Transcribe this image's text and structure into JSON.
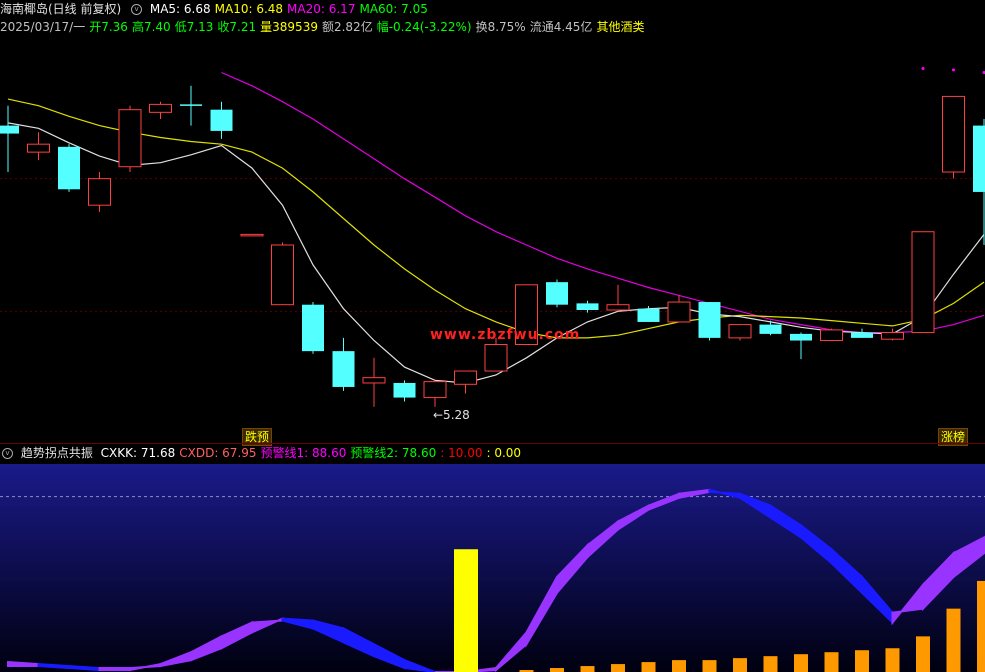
{
  "header": {
    "title": "海南椰岛(日线 前复权)",
    "ma": [
      {
        "label": "MA5: 6.68",
        "color": "#ffffff"
      },
      {
        "label": "MA10: 6.48",
        "color": "#ffff00"
      },
      {
        "label": "MA20: 6.17",
        "color": "#ff00ff"
      },
      {
        "label": "MA60: 7.05",
        "color": "#00ff00"
      }
    ],
    "quote": [
      {
        "label": "2025/03/17/一",
        "color": "#c0c0c0"
      },
      {
        "label": "开7.36",
        "color": "#00ff00"
      },
      {
        "label": "高7.40",
        "color": "#00ff00"
      },
      {
        "label": "低7.13",
        "color": "#00ff00"
      },
      {
        "label": "收7.21",
        "color": "#00ff00"
      },
      {
        "label": "量389539",
        "color": "#ffff00"
      },
      {
        "label": "额2.82亿",
        "color": "#c0c0c0"
      },
      {
        "label": "幅-0.24(-3.22%)",
        "color": "#00ff00"
      },
      {
        "label": "换8.75%",
        "color": "#c0c0c0"
      },
      {
        "label": "流通4.45亿",
        "color": "#c0c0c0"
      },
      {
        "label": "其他酒类",
        "color": "#ffff00"
      }
    ]
  },
  "indicator_header": {
    "name": "趋势拐点共振",
    "items": [
      {
        "label": "CXKK: 71.68",
        "color": "#ffffff"
      },
      {
        "label": "CXDD: 67.95",
        "color": "#ff6060"
      },
      {
        "label": "预警线1: 88.60",
        "color": "#ff00ff"
      },
      {
        "label": "预警线2: 78.60",
        "color": "#00ff00"
      },
      {
        "label": ": 10.00",
        "color": "#ff0000"
      },
      {
        "label": ": 0.00",
        "color": "#ffff00"
      }
    ]
  },
  "badges": {
    "left": "跌预",
    "right": "涨榜"
  },
  "low_label": "←5.28",
  "watermark": "www.zbzfwu.com",
  "colors": {
    "up": "#ff4040",
    "down": "#54ffff",
    "ma5": "#e0e0e0",
    "ma10": "#e0e000",
    "ma20": "#e000e0",
    "kk": "#9933ff",
    "dd": "#1a1aff",
    "bar": "#ffff00",
    "small_bar": "#ff9900"
  },
  "chart_data": [
    {
      "type": "candlestick",
      "title": "海南椰岛(日线 前复权)",
      "ylim": [
        5.0,
        8.0
      ],
      "candles": [
        {
          "o": 7.4,
          "c": 7.34,
          "h": 7.55,
          "l": 7.05
        },
        {
          "o": 7.2,
          "c": 7.26,
          "h": 7.35,
          "l": 7.14
        },
        {
          "o": 7.24,
          "c": 6.92,
          "h": 7.26,
          "l": 6.9
        },
        {
          "o": 6.8,
          "c": 7.0,
          "h": 7.05,
          "l": 6.75
        },
        {
          "o": 7.09,
          "c": 7.52,
          "h": 7.55,
          "l": 7.05
        },
        {
          "o": 7.5,
          "c": 7.56,
          "h": 7.58,
          "l": 7.45
        },
        {
          "o": 7.56,
          "c": 7.55,
          "h": 7.7,
          "l": 7.4
        },
        {
          "o": 7.52,
          "c": 7.36,
          "h": 7.58,
          "l": 7.3
        },
        {
          "o": 6.58,
          "c": 6.58,
          "h": 6.58,
          "l": 6.58
        },
        {
          "o": 6.05,
          "c": 6.5,
          "h": 6.52,
          "l": 6.05
        },
        {
          "o": 6.05,
          "c": 5.7,
          "h": 6.07,
          "l": 5.68
        },
        {
          "o": 5.7,
          "c": 5.43,
          "h": 5.8,
          "l": 5.4
        },
        {
          "o": 5.46,
          "c": 5.5,
          "h": 5.65,
          "l": 5.28
        },
        {
          "o": 5.46,
          "c": 5.35,
          "h": 5.48,
          "l": 5.32
        },
        {
          "o": 5.35,
          "c": 5.47,
          "h": 5.47,
          "l": 5.28
        },
        {
          "o": 5.45,
          "c": 5.55,
          "h": 5.55,
          "l": 5.38
        },
        {
          "o": 5.55,
          "c": 5.75,
          "h": 5.8,
          "l": 5.55
        },
        {
          "o": 5.75,
          "c": 6.2,
          "h": 6.2,
          "l": 5.75
        },
        {
          "o": 6.22,
          "c": 6.05,
          "h": 6.24,
          "l": 6.03
        },
        {
          "o": 6.06,
          "c": 6.01,
          "h": 6.08,
          "l": 5.99
        },
        {
          "o": 6.01,
          "c": 6.05,
          "h": 6.2,
          "l": 6.0
        },
        {
          "o": 6.02,
          "c": 5.92,
          "h": 6.04,
          "l": 5.92
        },
        {
          "o": 5.92,
          "c": 6.07,
          "h": 6.12,
          "l": 5.92
        },
        {
          "o": 6.07,
          "c": 5.8,
          "h": 6.07,
          "l": 5.78
        },
        {
          "o": 5.8,
          "c": 5.9,
          "h": 5.9,
          "l": 5.78
        },
        {
          "o": 5.9,
          "c": 5.83,
          "h": 5.93,
          "l": 5.82
        },
        {
          "o": 5.83,
          "c": 5.78,
          "h": 5.84,
          "l": 5.64
        },
        {
          "o": 5.78,
          "c": 5.86,
          "h": 5.87,
          "l": 5.78
        },
        {
          "o": 5.84,
          "c": 5.8,
          "h": 5.87,
          "l": 5.8
        },
        {
          "o": 5.79,
          "c": 5.84,
          "h": 5.87,
          "l": 5.78
        },
        {
          "o": 5.84,
          "c": 6.6,
          "h": 6.6,
          "l": 5.84
        },
        {
          "o": 7.05,
          "c": 7.62,
          "h": 7.62,
          "l": 7.0
        },
        {
          "o": 7.4,
          "c": 6.9,
          "h": 7.45,
          "l": 6.5
        }
      ],
      "ma5": [
        7.42,
        7.38,
        7.27,
        7.17,
        7.1,
        7.12,
        7.18,
        7.25,
        7.08,
        6.8,
        6.35,
        6.02,
        5.78,
        5.58,
        5.48,
        5.46,
        5.52,
        5.65,
        5.8,
        5.92,
        6.0,
        6.02,
        6.03,
        5.98,
        5.96,
        5.92,
        5.88,
        5.85,
        5.84,
        5.83,
        5.96,
        6.28,
        6.58
      ],
      "ma10": [
        7.6,
        7.55,
        7.47,
        7.4,
        7.35,
        7.31,
        7.28,
        7.26,
        7.2,
        7.08,
        6.9,
        6.7,
        6.5,
        6.32,
        6.16,
        6.02,
        5.92,
        5.84,
        5.8,
        5.8,
        5.82,
        5.87,
        5.92,
        5.95,
        5.97,
        5.96,
        5.95,
        5.93,
        5.91,
        5.89,
        5.94,
        6.06,
        6.22
      ],
      "ma20": [
        null,
        null,
        null,
        null,
        null,
        null,
        null,
        7.8,
        7.7,
        7.58,
        7.45,
        7.3,
        7.15,
        7.0,
        6.86,
        6.72,
        6.6,
        6.5,
        6.4,
        6.32,
        6.25,
        6.18,
        6.12,
        6.06,
        6.0,
        5.94,
        5.9,
        5.86,
        5.84,
        5.84,
        5.85,
        5.9,
        5.97
      ],
      "ma60_points": [
        {
          "i": 30,
          "v": 7.83
        },
        {
          "i": 31,
          "v": 7.82
        },
        {
          "i": 32,
          "v": 7.8
        }
      ]
    },
    {
      "type": "area",
      "title": "趋势拐点共振",
      "ylim": [
        0,
        100
      ],
      "reference_line": 88.6,
      "kk": [
        3,
        3,
        2,
        1,
        1,
        4,
        10,
        18,
        25,
        26,
        22,
        15,
        8,
        2,
        0,
        0,
        2,
        20,
        48,
        64,
        76,
        84,
        90,
        92,
        88,
        78,
        68,
        55,
        40,
        25,
        44,
        60,
        68
      ],
      "dd": [
        5,
        4,
        3,
        2,
        2,
        3,
        6,
        12,
        20,
        27,
        26,
        22,
        14,
        6,
        0,
        0,
        1,
        14,
        40,
        58,
        72,
        82,
        88,
        91,
        90,
        84,
        74,
        62,
        48,
        30,
        32,
        48,
        60
      ],
      "bar_index": 14,
      "bar_value": 62,
      "small_bars": [
        null,
        null,
        null,
        null,
        null,
        null,
        null,
        null,
        null,
        null,
        null,
        null,
        null,
        null,
        null,
        null,
        null,
        1,
        2,
        3,
        4,
        5,
        6,
        6,
        7,
        8,
        9,
        10,
        11,
        12,
        18,
        32,
        46
      ]
    }
  ]
}
